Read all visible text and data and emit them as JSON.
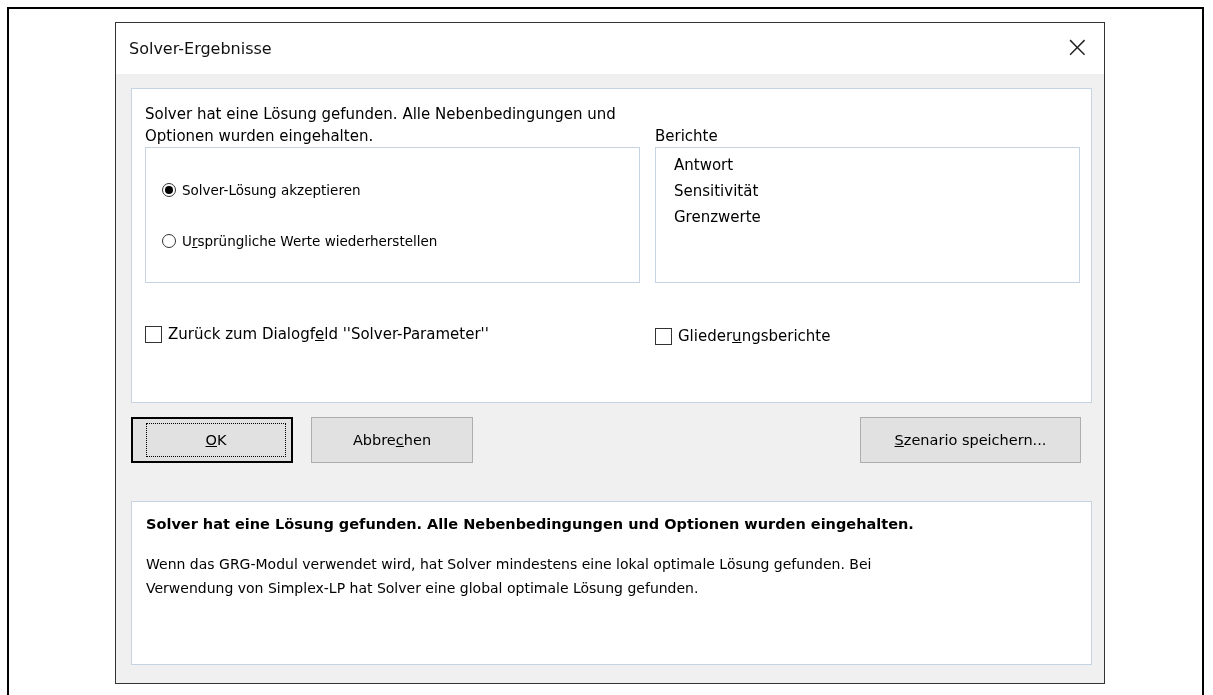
{
  "window": {
    "title": "Solver-Ergebnisse",
    "close": "×"
  },
  "message": "Solver hat eine Lösung gefunden. Alle Nebenbedingungen und Optionen wurden eingehalten.",
  "options": [
    {
      "label_start": "Solver-Lösung akzeptieren",
      "selected": true
    },
    {
      "label_start": "U",
      "access_key": "r",
      "label_end": "sprüngliche Werte wiederherstellen",
      "selected": false
    }
  ],
  "reports": {
    "label": "Berichte",
    "items": [
      {
        "label": "Antwort",
        "selected": false
      },
      {
        "label": "Sensitivität",
        "selected": false
      },
      {
        "label": "Grenzwerte",
        "selected": false
      }
    ]
  },
  "checkboxes": [
    {
      "label_start": "Zurück zum Dialogf",
      "access_key": "e",
      "label_end": "ld ''Solver-Parameter''",
      "checked": false
    },
    {
      "label_start": "Glieder",
      "access_key": "u",
      "label_end": "ngsberichte",
      "checked": false
    }
  ],
  "buttons": [
    {
      "access_key": "O",
      "label_end": "K",
      "default": true,
      "focused": true
    },
    {
      "label_start": "Abbre",
      "access_key": "c",
      "label_end": "hen",
      "default": false,
      "focused": false
    }
  ],
  "side_buttons": [
    {
      "access_key": "S",
      "label_end": "zenario speichern...",
      "default": false,
      "focused": false
    }
  ],
  "info": {
    "heading": "Solver hat eine Lösung gefunden. Alle Nebenbedingungen und Optionen wurden eingehalten.",
    "text": "Wenn das GRG-Modul verwendet wird, hat Solver mindestens eine lokal optimale Lösung gefunden. Bei Verwendung von Simplex-LP hat Solver eine global optimale Lösung gefunden."
  }
}
